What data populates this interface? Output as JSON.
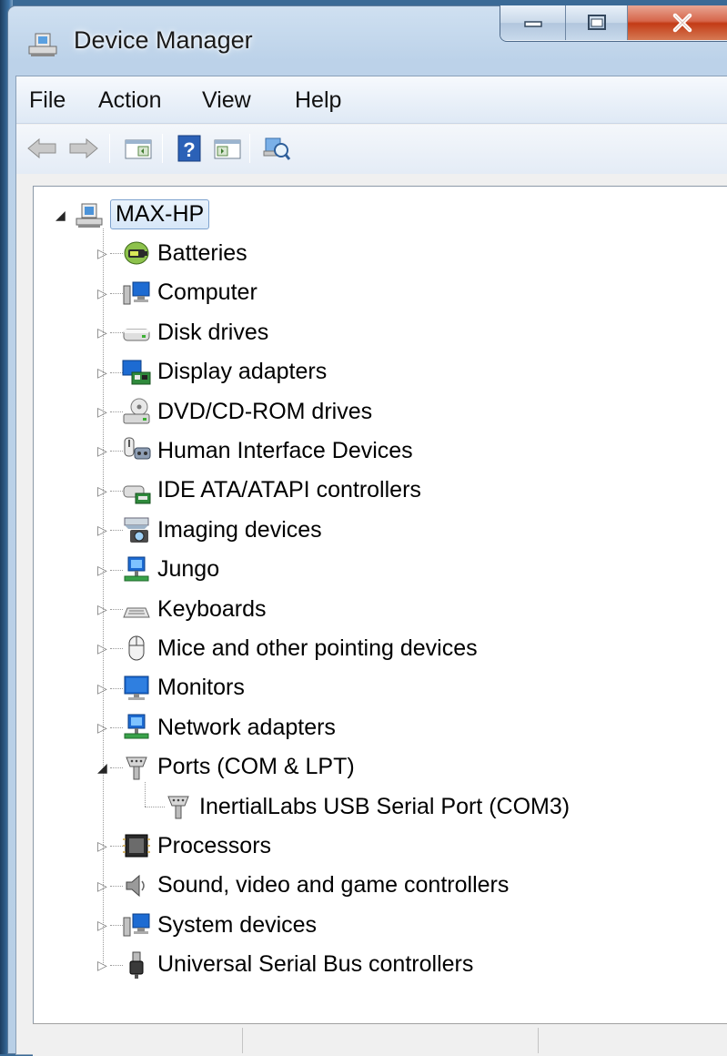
{
  "window": {
    "title": "Device Manager",
    "icon": "device-manager-icon"
  },
  "caption_buttons": {
    "minimize": "minimize-icon",
    "maximize": "maximize-icon",
    "close": "close-icon"
  },
  "menu": [
    {
      "label": "File"
    },
    {
      "label": "Action"
    },
    {
      "label": "View"
    },
    {
      "label": "Help"
    }
  ],
  "toolbar": [
    {
      "icon": "back-arrow-icon"
    },
    {
      "icon": "forward-arrow-icon"
    },
    {
      "icon": "show-hide-console-tree-icon"
    },
    {
      "icon": "help-icon"
    },
    {
      "icon": "show-hide-action-pane-icon"
    },
    {
      "icon": "scan-hardware-changes-icon"
    }
  ],
  "tree": {
    "root": {
      "label": "MAX-HP",
      "icon": "computer-icon",
      "expanded": true
    },
    "categories": [
      {
        "label": "Batteries",
        "icon": "battery-icon"
      },
      {
        "label": "Computer",
        "icon": "computer-monitor-icon"
      },
      {
        "label": "Disk drives",
        "icon": "disk-drive-icon"
      },
      {
        "label": "Display adapters",
        "icon": "display-adapter-icon"
      },
      {
        "label": "DVD/CD-ROM drives",
        "icon": "dvd-drive-icon"
      },
      {
        "label": "Human Interface Devices",
        "icon": "hid-icon"
      },
      {
        "label": "IDE ATA/ATAPI controllers",
        "icon": "ide-controller-icon"
      },
      {
        "label": "Imaging devices",
        "icon": "imaging-device-icon"
      },
      {
        "label": "Jungo",
        "icon": "jungo-network-icon"
      },
      {
        "label": "Keyboards",
        "icon": "keyboard-icon"
      },
      {
        "label": "Mice and other pointing devices",
        "icon": "mouse-icon"
      },
      {
        "label": "Monitors",
        "icon": "monitor-icon"
      },
      {
        "label": "Network adapters",
        "icon": "network-adapter-icon"
      },
      {
        "label": "Ports (COM & LPT)",
        "icon": "port-icon",
        "expanded": true,
        "children": [
          {
            "label": "InertialLabs USB Serial Port (COM3)",
            "icon": "port-icon"
          }
        ]
      },
      {
        "label": "Processors",
        "icon": "processor-icon"
      },
      {
        "label": "Sound, video and game controllers",
        "icon": "speaker-icon"
      },
      {
        "label": "System devices",
        "icon": "system-device-icon"
      },
      {
        "label": "Universal Serial Bus controllers",
        "icon": "usb-icon"
      }
    ]
  },
  "statusbar": {
    "parts": [
      "",
      "",
      ""
    ]
  }
}
